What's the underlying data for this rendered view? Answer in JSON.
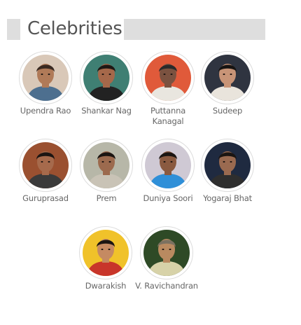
{
  "section": {
    "title": "Celebrities"
  },
  "celebrities": [
    {
      "name": "Upendra Rao",
      "bg": "#d9c8b8",
      "skin": "#b07a58",
      "hair": "#3a2a22",
      "shirt": "#4d6f8f"
    },
    {
      "name": "Shankar Nag",
      "bg": "#3f7f73",
      "skin": "#a5684a",
      "hair": "#1e1714",
      "shirt": "#222222"
    },
    {
      "name": "Puttanna Kanagal",
      "bg": "#e05a3a",
      "skin": "#7b5240",
      "hair": "#2a2a2a",
      "shirt": "#e9e6df"
    },
    {
      "name": "Sudeep",
      "bg": "#2f3440",
      "skin": "#c89477",
      "hair": "#171412",
      "shirt": "#e9e4dc"
    },
    {
      "name": "Guruprasad",
      "bg": "#9a5030",
      "skin": "#a66a4c",
      "hair": "#1c1512",
      "shirt": "#3a3a3a"
    },
    {
      "name": "Prem",
      "bg": "#b7b7a8",
      "skin": "#9c6a4e",
      "hair": "#1b1512",
      "shirt": "#c9c3b6"
    },
    {
      "name": "Duniya Soori",
      "bg": "#cfc9d4",
      "skin": "#8a5a40",
      "hair": "#1a1512",
      "shirt": "#2f8fd8"
    },
    {
      "name": "Yogaraj Bhat",
      "bg": "#1f2a40",
      "skin": "#9a6a50",
      "hair": "#1b1512",
      "shirt": "#2e2e2e"
    },
    {
      "name": "Dwarakish",
      "bg": "#f0c22a",
      "skin": "#c58a62",
      "hair": "#1b1512",
      "shirt": "#c8352a"
    },
    {
      "name": "V. Ravichandran",
      "bg": "#2e4a26",
      "skin": "#b98a60",
      "hair": "#7b7160",
      "shirt": "#d7d2a8"
    }
  ]
}
